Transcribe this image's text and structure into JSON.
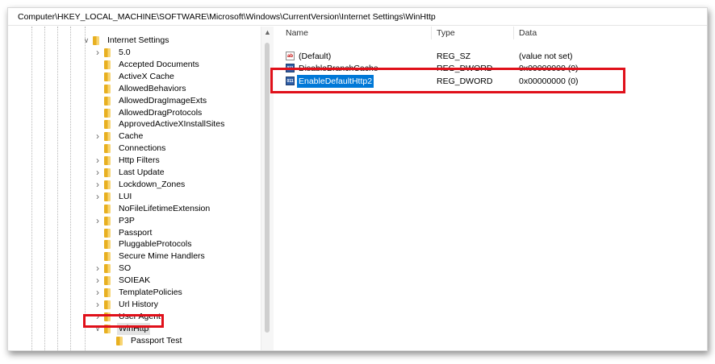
{
  "address_path": "Computer\\HKEY_LOCAL_MACHINE\\SOFTWARE\\Microsoft\\Windows\\CurrentVersion\\Internet Settings\\WinHttp",
  "tree": {
    "parent": {
      "label": "Internet Settings",
      "expanded": true
    },
    "children": [
      {
        "label": "5.0",
        "expandable": true
      },
      {
        "label": "Accepted Documents",
        "expandable": false
      },
      {
        "label": "ActiveX Cache",
        "expandable": false
      },
      {
        "label": "AllowedBehaviors",
        "expandable": false
      },
      {
        "label": "AllowedDragImageExts",
        "expandable": false
      },
      {
        "label": "AllowedDragProtocols",
        "expandable": false
      },
      {
        "label": "ApprovedActiveXInstallSites",
        "expandable": false
      },
      {
        "label": "Cache",
        "expandable": true
      },
      {
        "label": "Connections",
        "expandable": false
      },
      {
        "label": "Http Filters",
        "expandable": true
      },
      {
        "label": "Last Update",
        "expandable": true
      },
      {
        "label": "Lockdown_Zones",
        "expandable": true
      },
      {
        "label": "LUI",
        "expandable": true
      },
      {
        "label": "NoFileLifetimeExtension",
        "expandable": false
      },
      {
        "label": "P3P",
        "expandable": true
      },
      {
        "label": "Passport",
        "expandable": false
      },
      {
        "label": "PluggableProtocols",
        "expandable": false
      },
      {
        "label": "Secure Mime Handlers",
        "expandable": false
      },
      {
        "label": "SO",
        "expandable": true
      },
      {
        "label": "SOIEAK",
        "expandable": true
      },
      {
        "label": "TemplatePolicies",
        "expandable": true
      },
      {
        "label": "Url History",
        "expandable": true
      },
      {
        "label": "User Agent",
        "expandable": true
      },
      {
        "label": "WinHttp",
        "expandable": true,
        "expanded": true,
        "selected": true
      }
    ],
    "grandchildren": [
      {
        "label": "Passport Test"
      }
    ]
  },
  "list": {
    "headers": {
      "name": "Name",
      "type": "Type",
      "data": "Data"
    },
    "rows": [
      {
        "name": "(Default)",
        "type": "REG_SZ",
        "data": "(value not set)",
        "icon": "string-value-icon",
        "selected": false
      },
      {
        "name": "DisableBranchCache",
        "type": "REG_DWORD",
        "data": "0x00000000 (0)",
        "icon": "binary-value-icon",
        "selected": false
      },
      {
        "name": "EnableDefaultHttp2",
        "type": "REG_DWORD",
        "data": "0x00000000 (0)",
        "icon": "binary-value-icon",
        "selected": true
      }
    ]
  },
  "colors": {
    "highlight": "#e0101a",
    "selection": "#0078d7",
    "folder": "#e8b021"
  }
}
